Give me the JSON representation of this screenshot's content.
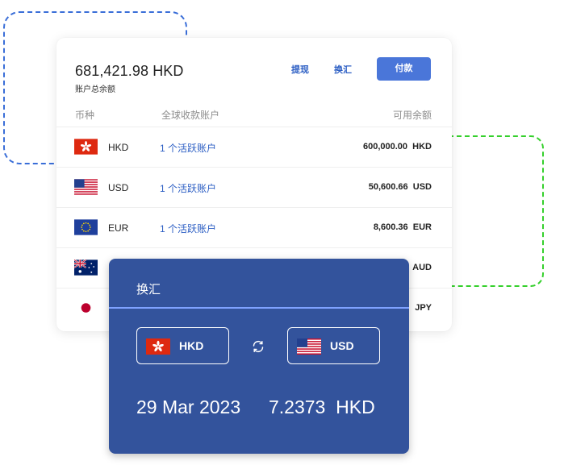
{
  "account": {
    "total_amount": "681,421.98 HKD",
    "total_label": "账户总余额"
  },
  "actions": {
    "withdraw": "提现",
    "exchange": "换汇",
    "pay": "付款"
  },
  "table": {
    "headers": {
      "currency": "币种",
      "account": "全球收款账户",
      "balance": "可用余额"
    },
    "rows": [
      {
        "currency": "HKD",
        "account": "1 个活跃账户",
        "balance": "600,000.00",
        "unit": "HKD",
        "flag": "hong-kong-flag"
      },
      {
        "currency": "USD",
        "account": "1 个活跃账户",
        "balance": "50,600.66",
        "unit": "USD",
        "flag": "us-flag"
      },
      {
        "currency": "EUR",
        "account": "1 个活跃账户",
        "balance": "8,600.36",
        "unit": "EUR",
        "flag": "eu-flag"
      },
      {
        "currency": "",
        "account": "",
        "balance": "",
        "unit": "AUD",
        "flag": "australia-flag"
      },
      {
        "currency": "",
        "account": "",
        "balance": "",
        "unit": "JPY",
        "flag": "japan-flag"
      }
    ]
  },
  "exchange_panel": {
    "title": "换汇",
    "from_currency": "HKD",
    "to_currency": "USD",
    "swap_icon": "swap-icon",
    "date": "29 Mar 2023",
    "rate": "7.2373",
    "rate_unit": "HKD"
  },
  "colors": {
    "link": "#2d5fc4",
    "primary_button": "#4a76d9",
    "panel_bg": "#33539c",
    "panel_divider": "#7fa2ff",
    "dashed_blue": "#3a6ed8",
    "dashed_green": "#35d02c"
  }
}
